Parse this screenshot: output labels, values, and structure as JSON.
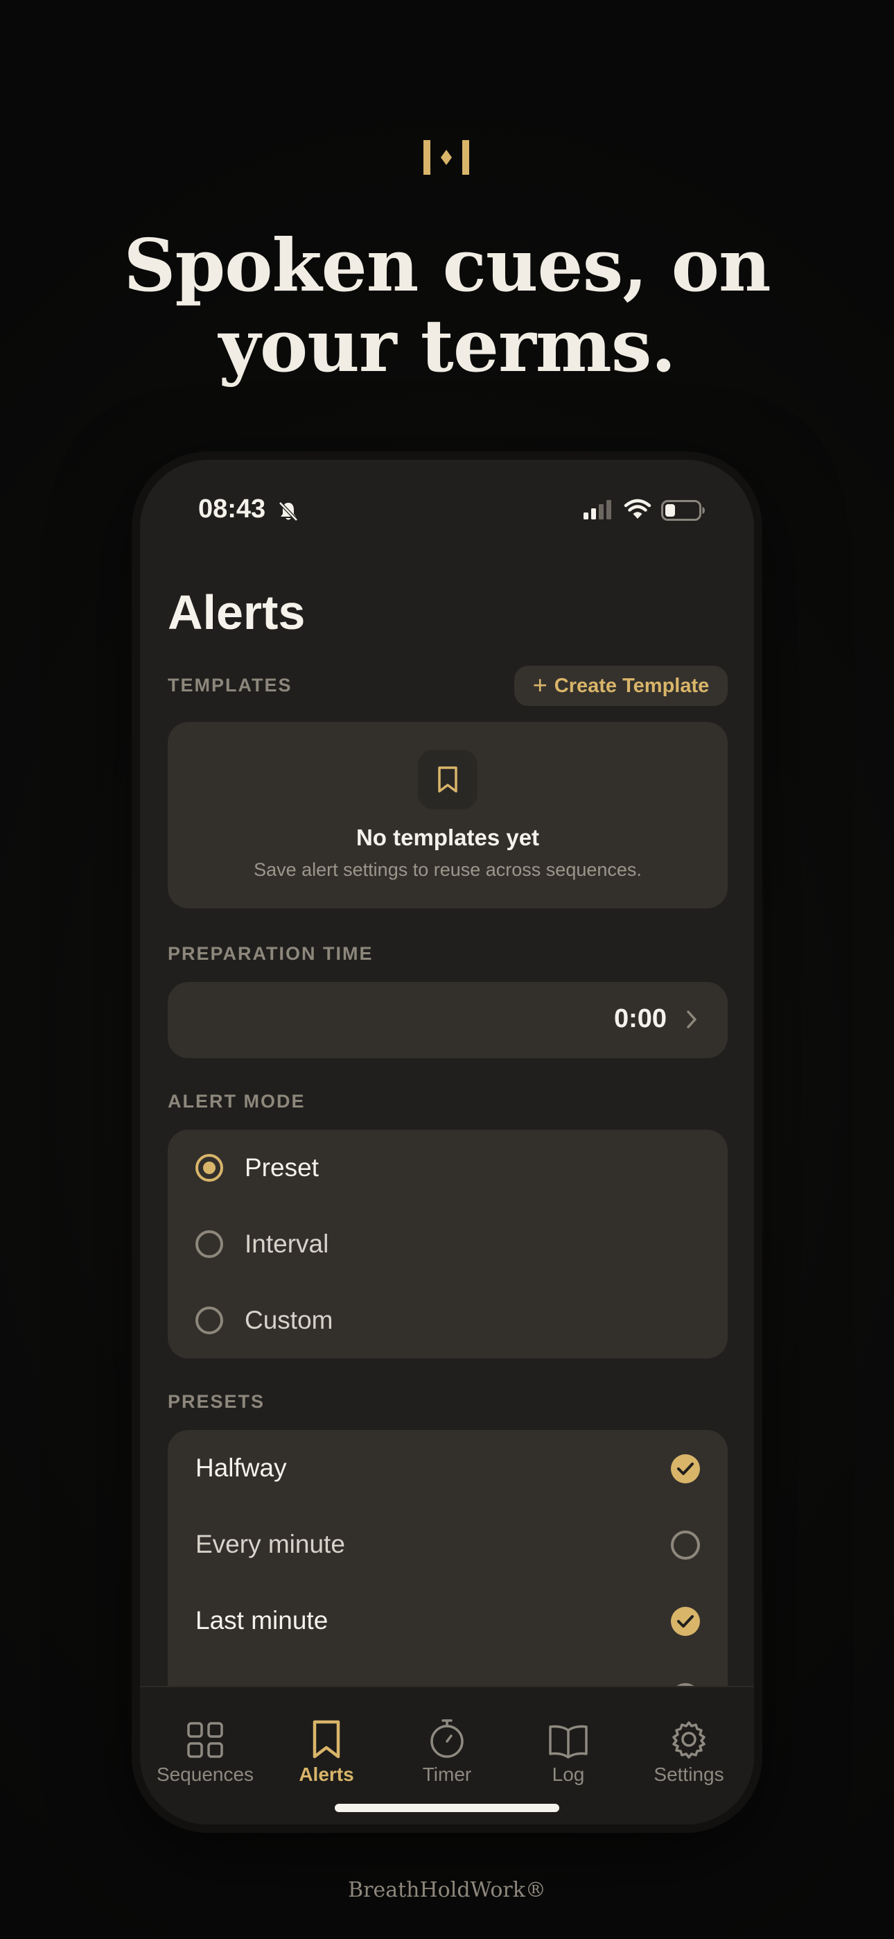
{
  "headline": {
    "line1": "Spoken cues, on",
    "line2": "your terms."
  },
  "status_bar": {
    "time": "08:43"
  },
  "screen": {
    "title": "Alerts"
  },
  "templates": {
    "label": "TEMPLATES",
    "create_button": "Create Template",
    "empty_title": "No templates yet",
    "empty_subtitle": "Save alert settings to reuse across sequences."
  },
  "preparation": {
    "label": "PREPARATION TIME",
    "value": "0:00"
  },
  "alert_mode": {
    "label": "ALERT MODE",
    "options": [
      {
        "label": "Preset",
        "selected": true
      },
      {
        "label": "Interval",
        "selected": false
      },
      {
        "label": "Custom",
        "selected": false
      }
    ]
  },
  "presets": {
    "label": "PRESETS",
    "items": [
      {
        "label": "Halfway",
        "checked": true
      },
      {
        "label": "Every minute",
        "checked": false
      },
      {
        "label": "Last minute",
        "checked": true
      }
    ]
  },
  "tabs": [
    {
      "label": "Sequences",
      "icon": "grid-icon",
      "active": false
    },
    {
      "label": "Alerts",
      "icon": "bookmark-icon",
      "active": true
    },
    {
      "label": "Timer",
      "icon": "stopwatch-icon",
      "active": false
    },
    {
      "label": "Log",
      "icon": "book-icon",
      "active": false
    },
    {
      "label": "Settings",
      "icon": "gear-icon",
      "active": false
    }
  ],
  "footer": {
    "brand": "BreathHoldWork®"
  },
  "colors": {
    "accent": "#d9b56a",
    "background": "#0b0b0a",
    "card": "#33302c",
    "text": "#f5f2ec"
  }
}
